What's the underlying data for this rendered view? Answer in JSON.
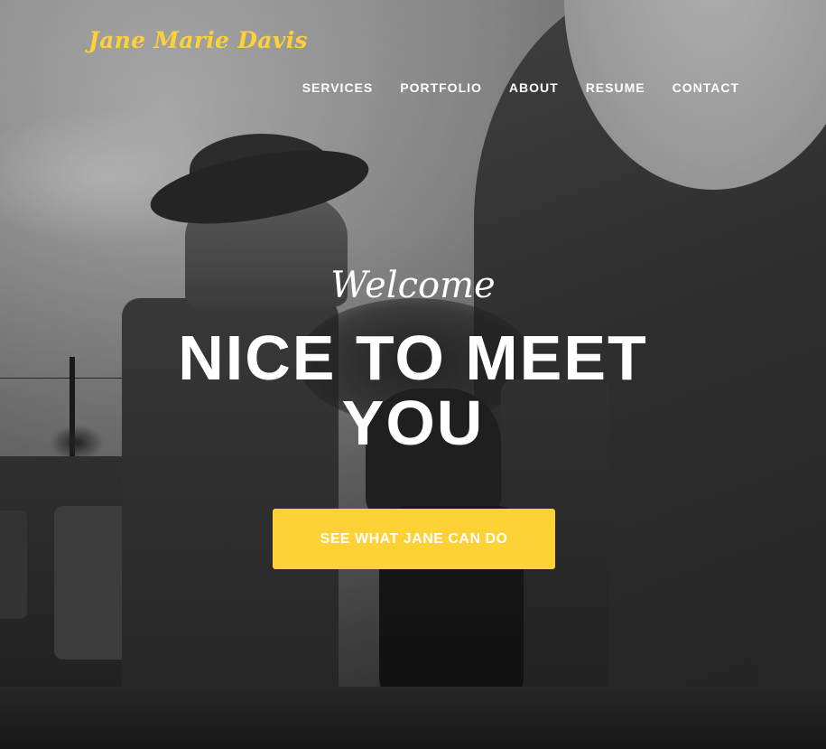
{
  "header": {
    "brand": "Jane Marie Davis",
    "nav": [
      {
        "label": "SERVICES"
      },
      {
        "label": "PORTFOLIO"
      },
      {
        "label": "ABOUT"
      },
      {
        "label": "RESUME"
      },
      {
        "label": "CONTACT"
      }
    ]
  },
  "hero": {
    "lead_in": "Welcome",
    "heading": "NICE TO MEET YOU",
    "cta_label": "SEE WHAT JANE CAN DO",
    "background_image": "black-and-white photo of a person seated on a carved stone throne with a crescent moon sculpture"
  },
  "colors": {
    "accent": "#fed136",
    "text": "#ffffff"
  }
}
